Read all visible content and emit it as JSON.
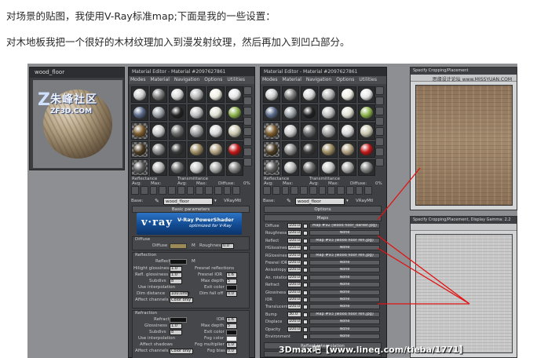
{
  "article": {
    "intro_line_1": "对场景的贴图，我使用V-Ray标准map;下面是我的一些设置：",
    "intro_line_2": "对木地板我把一个很好的木材纹理加入到漫发射纹理，然后再加入到凹凸部分。"
  },
  "preview_window": {
    "title": "wood_floor"
  },
  "watermark": {
    "big": "朱峰社区",
    "small": "ZF3D.COM",
    "footer": "3Dmax吧【www.lineq.com/tieba/1771】"
  },
  "editor_left": {
    "title": "Material Editor - Material #2097627861",
    "menu": [
      "Modes",
      "Material",
      "Navigation",
      "Options",
      "Utilities"
    ],
    "reflectance_label": "Reflectance",
    "transmittance_label": "Transmittance",
    "avg_label": "Avg:",
    "max_label": "Max:",
    "diffuse_label": "Diffuse:",
    "diffuse_pct": "0%",
    "base_label": "Base:",
    "material_name": "wood_floor",
    "material_type": "VRayMtl",
    "rollout": "Basic parameters",
    "vray_brand": "v·ray",
    "vray_title": "V-Ray PowerShader",
    "vray_sub": "optimized for V-Ray",
    "diffuse_group": "Diffuse",
    "diffuse_field": "Diffuse",
    "roughness_label": "Roughness",
    "roughness_value": "0.0",
    "reflection_group": "Reflection",
    "reflect_label": "Reflect",
    "hilight_label": "Hilight glossiness",
    "hilight_value": "1.0",
    "refl_gloss_label": "Refl. glossiness",
    "refl_gloss_value": "1.0",
    "subdivs_label": "Subdivs",
    "subdivs_value": "8",
    "use_interp_label": "Use interpolation",
    "dim_distance_label": "Dim distance",
    "dim_distance_value": "100.0mm",
    "affect_channels_label": "Affect channels",
    "affect_channels_value": "Color only",
    "fresnel_label": "Fresnel reflections",
    "fresnel_ior_label": "Fresnel IOR",
    "fresnel_ior_value": "1.6",
    "max_depth_label": "Max depth",
    "max_depth_value": "5",
    "exit_color_label": "Exit color",
    "dim_falloff_label": "Dim fall off",
    "dim_falloff_value": "0.0",
    "refraction_group": "Refraction",
    "refract_label": "Refract",
    "ior_label": "IOR",
    "ior_value": "1.6",
    "glossiness_label": "Glossiness",
    "glossiness_value": "1.0",
    "refr_subdivs_label": "Subdivs",
    "refr_subdivs_value": "8",
    "refr_max_depth_value": "5",
    "refr_use_interp_label": "Use interpolation",
    "affect_shadows_label": "Affect shadows",
    "refr_affect_label": "Affect channels",
    "refr_affect_value": "Color only",
    "refr_exit_label": "Exit color",
    "fog_color_label": "Fog color",
    "fog_mult_label": "Fog multiplier",
    "fog_mult_value": "1.0",
    "fog_bias_label": "Fog bias",
    "fog_bias_value": "0.0"
  },
  "editor_right": {
    "title": "Material Editor - Material #2097627861",
    "menu": [
      "Modes",
      "Material",
      "Navigation",
      "Options",
      "Utilities"
    ],
    "reflectance_label": "Reflectance",
    "transmittance_label": "Transmittance",
    "avg_label": "Avg:",
    "max_label": "Max:",
    "diffuse_label": "Diffuse:",
    "diffuse_pct": "0%",
    "base_label": "Base:",
    "material_name": "wood_floor",
    "material_type": "VRayMtl",
    "options_rollout": "Options",
    "maps_rollout": "Maps",
    "maps": [
      {
        "name": "Diffuse",
        "value": "100.0",
        "map": "Map #92 (wood floor_darker.jpg)"
      },
      {
        "name": "Roughness",
        "value": "100.0",
        "map": "None"
      },
      {
        "name": "Reflect",
        "value": "100.0",
        "map": "Map #93 (wood floor refl.jpg)"
      },
      {
        "name": "HGlossiness",
        "value": "100.0",
        "map": "None"
      },
      {
        "name": "RGlossiness",
        "value": "100.0",
        "map": "Map #93 (wood floor refl.jpg)"
      },
      {
        "name": "Fresnel IOR",
        "value": "100.0",
        "map": "None"
      },
      {
        "name": "Anisotropy",
        "value": "100.0",
        "map": "None"
      },
      {
        "name": "An. rotation",
        "value": "100.0",
        "map": "None"
      },
      {
        "name": "Refract",
        "value": "100.0",
        "map": "None"
      },
      {
        "name": "Glossiness",
        "value": "100.0",
        "map": "None"
      },
      {
        "name": "IOR",
        "value": "100.0",
        "map": "None"
      },
      {
        "name": "Translucent",
        "value": "100.0",
        "map": "None"
      },
      {
        "name": "Bump",
        "value": "30.0",
        "map": "Map #93 (wood floor refl.jpg)"
      },
      {
        "name": "Displace",
        "value": "100.0",
        "map": "None"
      },
      {
        "name": "Opacity",
        "value": "100.0",
        "map": "None"
      },
      {
        "name": "Environment",
        "value": "",
        "map": "None"
      }
    ],
    "reflect_interp_rollout": "Reflect interpolation"
  },
  "texture_top": {
    "title": "Specify Cropping/Placement",
    "watermark": "思缘设计论坛 www.MISSYUAN.COM"
  },
  "texture_bottom": {
    "title": "Specify Cropping/Placement, Display Gamma: 2.2"
  }
}
